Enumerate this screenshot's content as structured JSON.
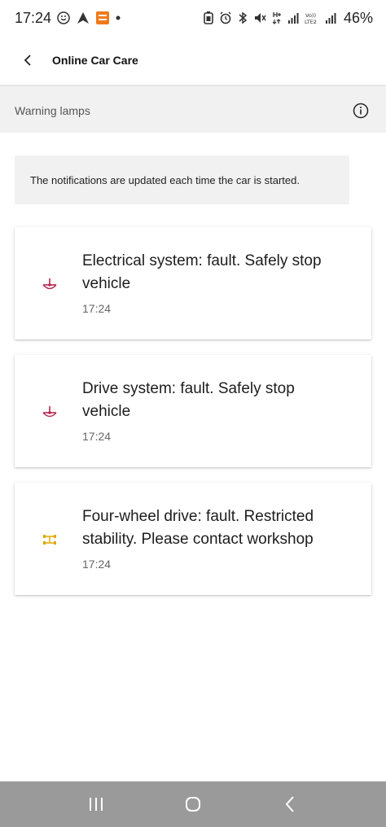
{
  "status_bar": {
    "time": "17:24",
    "battery_percent": "46%",
    "icons_left": [
      "messenger-icon",
      "navigation-app-icon",
      "shopping-app-icon",
      "dot-icon"
    ],
    "icons_right": [
      "battery-saver-icon",
      "alarm-icon",
      "bluetooth-icon",
      "mute-icon",
      "hplus-data-icon",
      "signal-icon",
      "volte-icon",
      "signal-icon"
    ]
  },
  "header": {
    "title": "Online Car Care"
  },
  "section": {
    "title": "Warning lamps"
  },
  "notice": {
    "text": "The notifications are updated each time the car is started."
  },
  "warnings": [
    {
      "message": "Electrical system: fault. Safely stop vehicle",
      "time": "17:24",
      "icon": "electrical-warning-icon",
      "color": "#b5284b"
    },
    {
      "message": "Drive system: fault. Safely stop vehicle",
      "time": "17:24",
      "icon": "drive-system-warning-icon",
      "color": "#b5284b"
    },
    {
      "message": "Four-wheel drive: fault. Restricted stability. Please contact workshop",
      "time": "17:24",
      "icon": "four-wheel-drive-icon",
      "color": "#e0a800"
    }
  ],
  "nav_bar": {
    "buttons": [
      "recent-apps-icon",
      "home-icon",
      "back-icon"
    ]
  }
}
